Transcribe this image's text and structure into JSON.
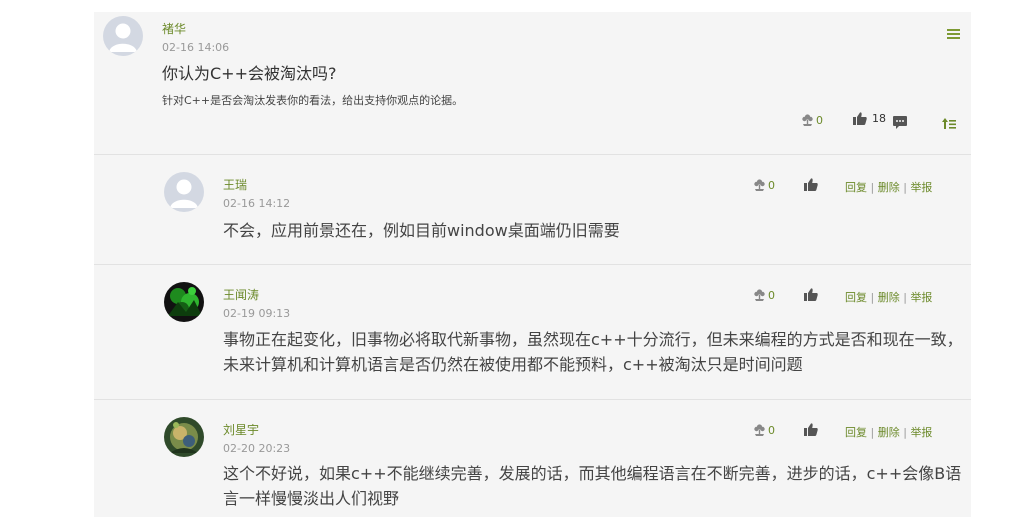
{
  "post": {
    "author": "褚华",
    "date": "02-16 14:06",
    "title": "你认为C++会被淘汰吗?",
    "description": "针对C++是否会淘汰发表你的看法，给出支持你观点的论据。",
    "flower_count": "0",
    "like_count": "18",
    "icons": [
      "menu-icon",
      "flower-icon",
      "thumbs-up-icon",
      "comment-icon",
      "sort-top-icon"
    ]
  },
  "reply_actions": {
    "reply": "回复",
    "delete": "删除",
    "report": "举报",
    "separator": "|"
  },
  "replies": [
    {
      "author": "王瑞",
      "date": "02-16 14:12",
      "text": "不会，应用前景还在，例如目前window桌面端仍旧需要",
      "flower_count": "0"
    },
    {
      "author": "王闻涛",
      "date": "02-19 09:13",
      "text": "事物正在起变化，旧事物必将取代新事物，虽然现在c++十分流行，但未来编程的方式是否和现在一致，未来计算机和计算机语言是否仍然在被使用都不能预料，c++被淘汰只是时间问题",
      "flower_count": "0"
    },
    {
      "author": "刘星宇",
      "date": "02-20 20:23",
      "text": "这个不好说，如果c++不能继续完善，发展的话，而其他编程语言在不断完善，进步的话，c++会像B语言一样慢慢淡出人们视野",
      "flower_count": "0"
    }
  ],
  "colors": {
    "accent": "#6c8a2a",
    "panel_bg": "#f5f5f5",
    "divider": "#e2e2e2"
  }
}
